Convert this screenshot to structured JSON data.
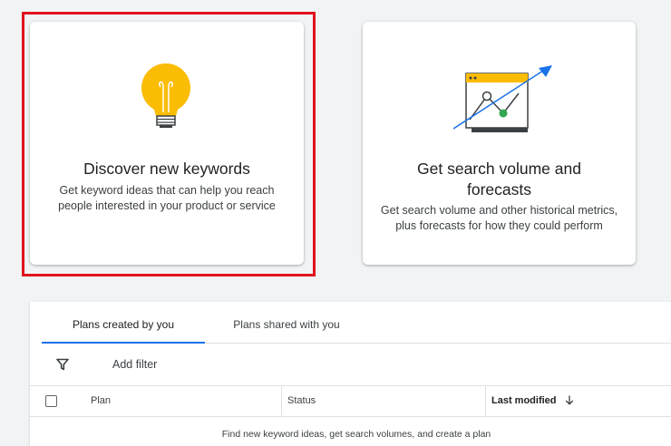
{
  "cards": {
    "discover": {
      "title": "Discover new keywords",
      "description": "Get keyword ideas that can help you reach people interested in your product or service",
      "icon": "lightbulb-icon"
    },
    "forecast": {
      "title": "Get search volume and forecasts",
      "description": "Get search volume and other historical metrics, plus forecasts for how they could perform",
      "icon": "trend-chart-icon"
    }
  },
  "tabs": [
    {
      "label": "Plans created by you",
      "active": true
    },
    {
      "label": "Plans shared with you",
      "active": false
    }
  ],
  "filter": {
    "label": "Add filter",
    "icon": "filter-icon"
  },
  "table": {
    "columns": [
      "Plan",
      "Status",
      "Last modified"
    ],
    "sort_icon": "arrow-down-icon",
    "empty_message": "Find new keyword ideas, get search volumes, and create a plan"
  },
  "colors": {
    "accent": "#1a73e8",
    "highlight": "#e0141e",
    "bulb": "#fbbc04",
    "green": "#34a853"
  }
}
